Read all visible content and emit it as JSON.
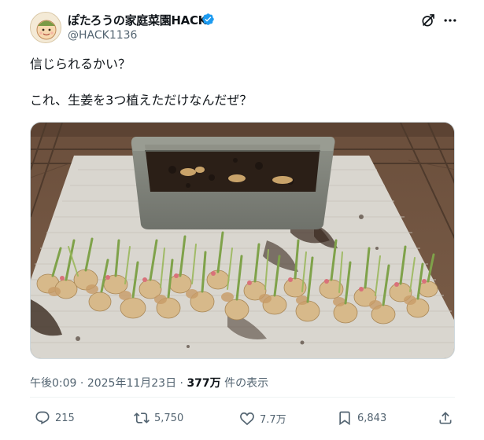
{
  "author": {
    "name": "ぽたろうの家庭菜園HACK",
    "handle": "@HACK1136"
  },
  "tweet": {
    "line1": "信じられるかい？",
    "line2": "これ、生姜を3つ植えただけなんだぜ？"
  },
  "meta": {
    "time": "午後0:09",
    "separator": " · ",
    "date": "2025年11月23日",
    "views_count": "377万",
    "views_label": " 件の表示"
  },
  "actions": {
    "reply_count": "215",
    "retweet_count": "5,750",
    "like_count": "7.7万",
    "bookmark_count": "6,843"
  },
  "icons": {
    "verified": "verified-badge-icon",
    "grok": "grok-icon",
    "more": "more-icon",
    "reply": "reply-icon",
    "retweet": "retweet-icon",
    "like": "heart-icon",
    "bookmark": "bookmark-icon",
    "share": "share-icon"
  },
  "colors": {
    "text": "#0f1419",
    "secondary": "#536471",
    "verified": "#1d9bf0",
    "divider": "#eff3f4"
  }
}
